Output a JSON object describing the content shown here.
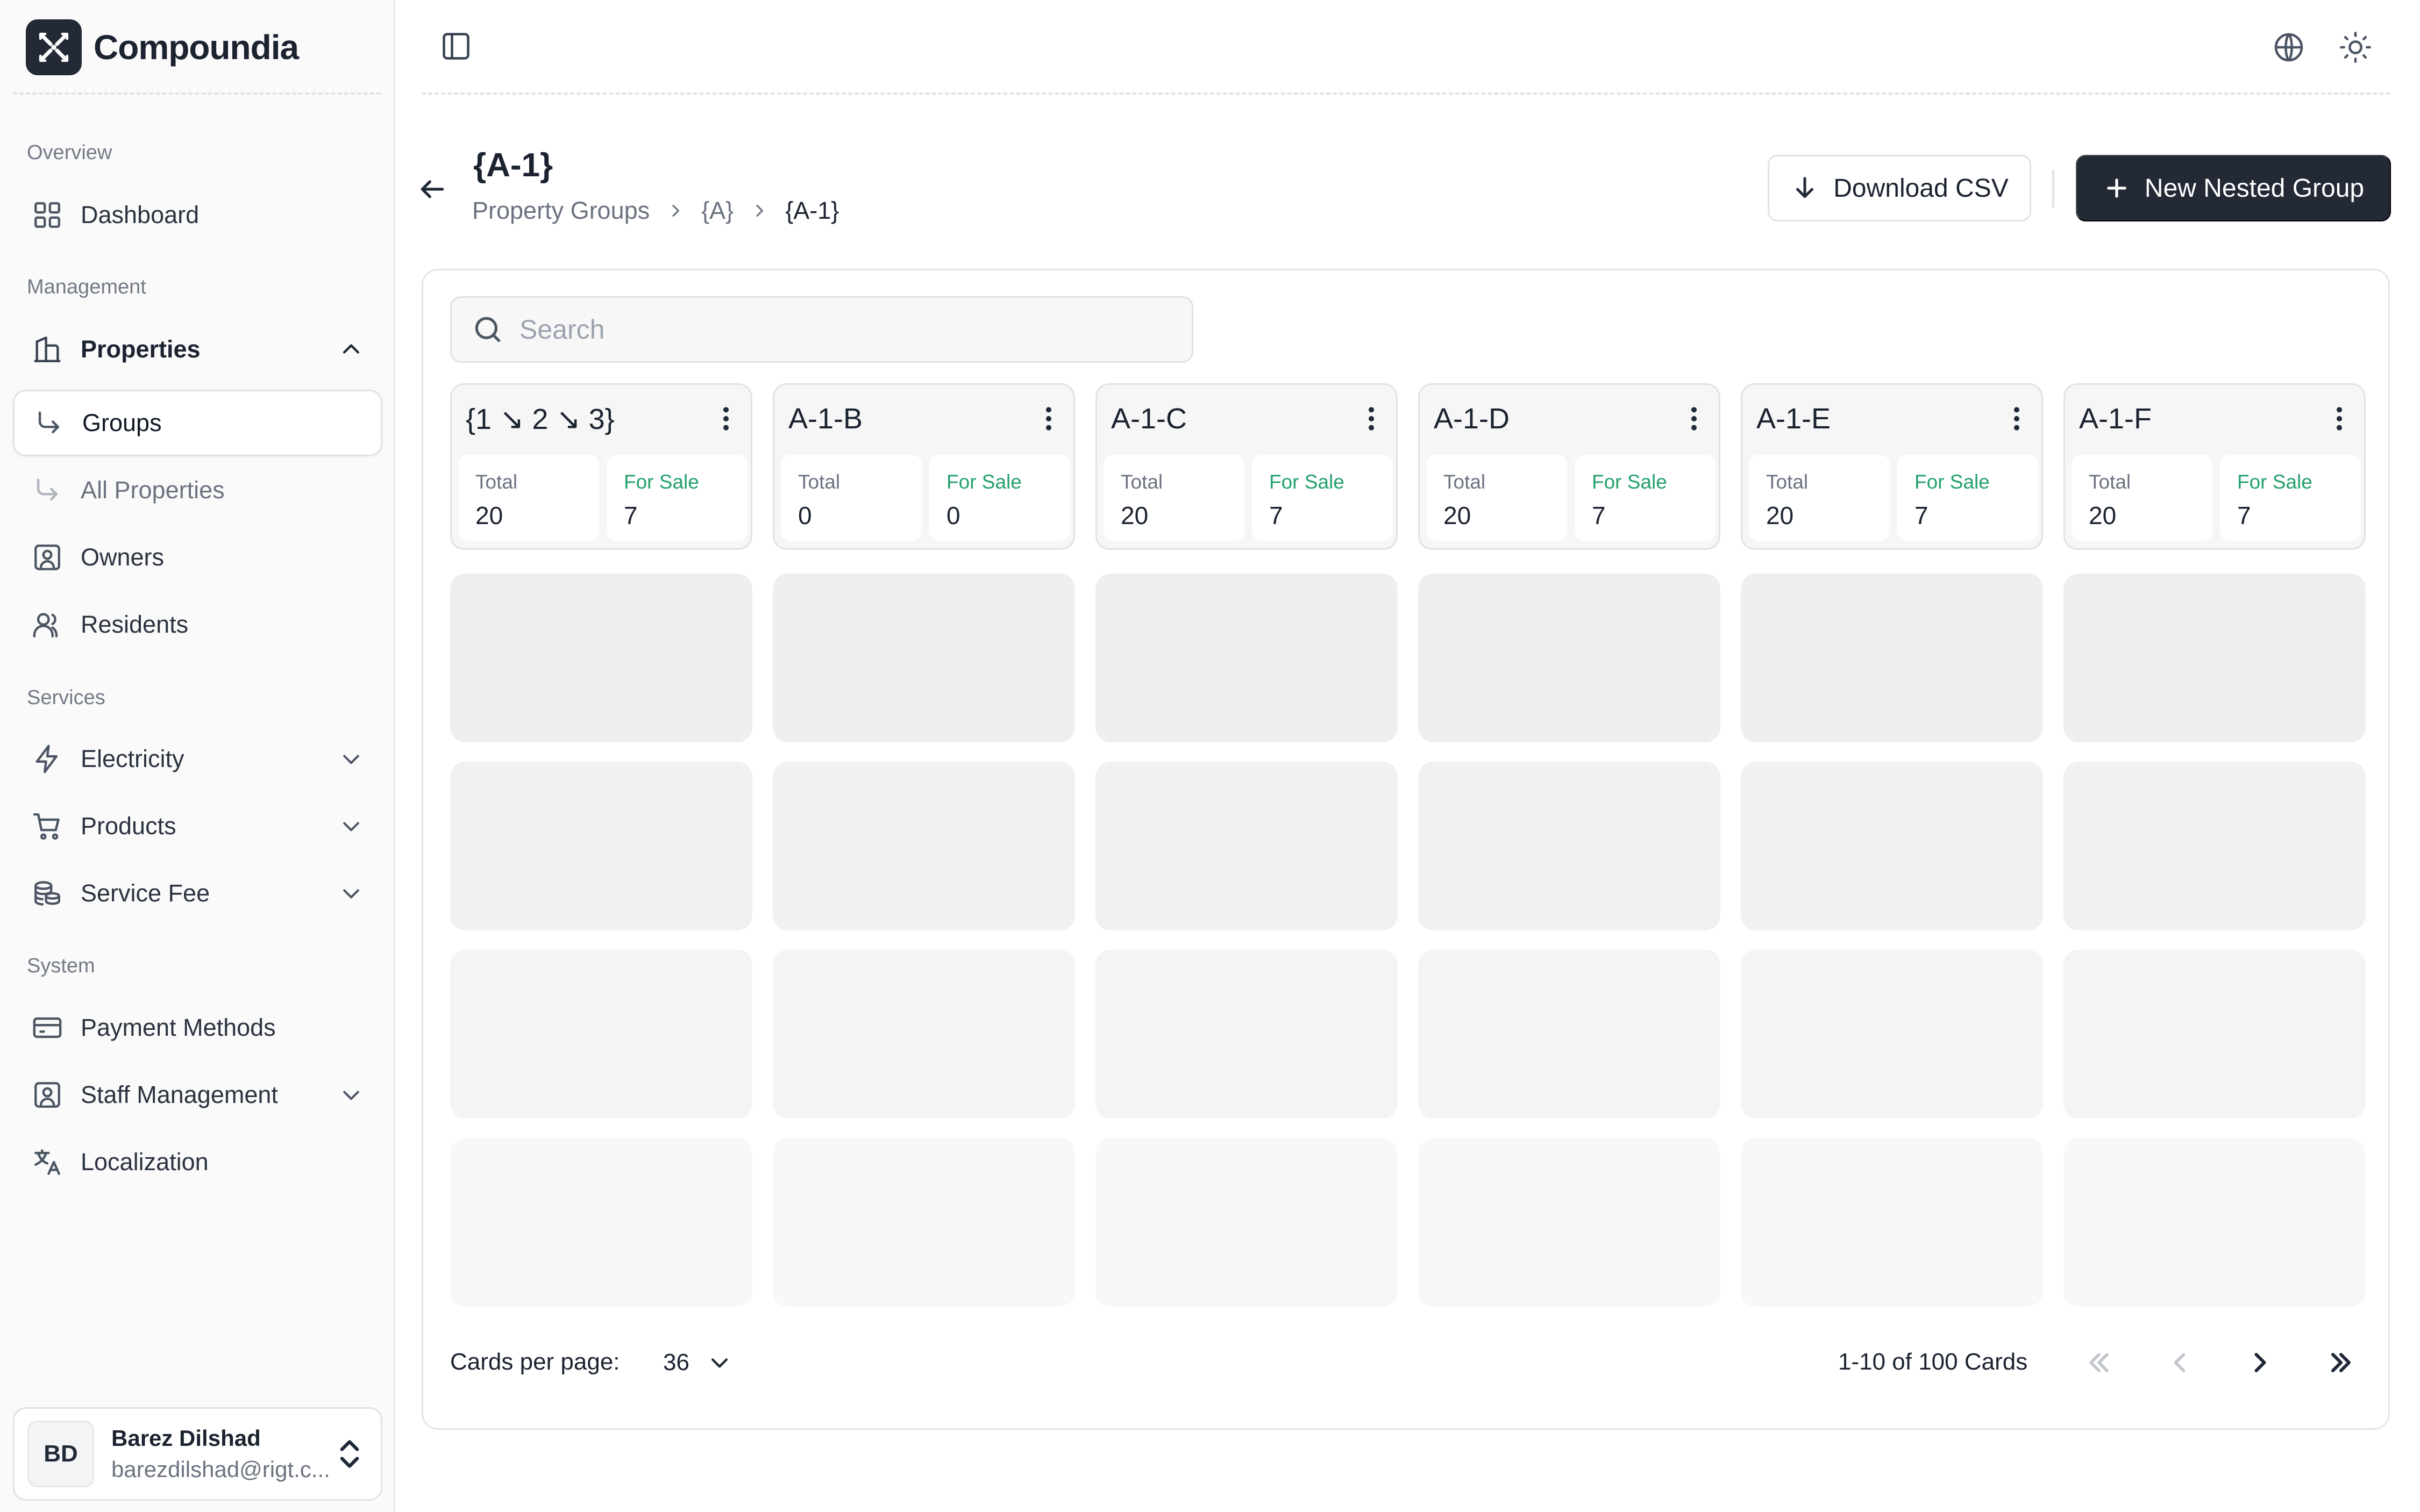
{
  "app": {
    "brand_name": "Compoundia"
  },
  "sidebar": {
    "sections": [
      {
        "label": "Overview"
      },
      {
        "label": "Management"
      },
      {
        "label": "Services"
      },
      {
        "label": "System"
      }
    ],
    "items": [
      {
        "label": "Dashboard",
        "icon": "dashboard-grid-icon"
      },
      {
        "label": "Properties",
        "icon": "building-icon",
        "expanded": true
      },
      {
        "label": "Groups",
        "icon": "sub-arrow-icon",
        "active": true
      },
      {
        "label": "All Properties",
        "icon": "sub-arrow-icon"
      },
      {
        "label": "Owners",
        "icon": "owner-id-icon"
      },
      {
        "label": "Residents",
        "icon": "users-icon"
      },
      {
        "label": "Electricity",
        "icon": "lightning-icon"
      },
      {
        "label": "Products",
        "icon": "shopping-cart-icon"
      },
      {
        "label": "Service Fee",
        "icon": "coins-icon"
      },
      {
        "label": "Payment Methods",
        "icon": "credit-card-icon"
      },
      {
        "label": "Staff Management",
        "icon": "staff-id-icon"
      },
      {
        "label": "Localization",
        "icon": "translate-icon"
      }
    ],
    "user": {
      "initials": "BD",
      "name": "Barez Dilshad",
      "email": "barezdilshad@rigt.c..."
    }
  },
  "header": {
    "title": "{A-1}",
    "breadcrumb": [
      "Property Groups",
      "{A}",
      "{A-1}"
    ],
    "download_label": "Download CSV",
    "new_group_label": "New Nested Group"
  },
  "search": {
    "placeholder": "Search",
    "value": ""
  },
  "cards": [
    {
      "title": "{1 ↘ 2 ↘ 3}",
      "total_label": "Total",
      "total": "20",
      "for_sale_label": "For Sale",
      "for_sale": "7"
    },
    {
      "title": "A-1-B",
      "total_label": "Total",
      "total": "0",
      "for_sale_label": "For Sale",
      "for_sale": "0"
    },
    {
      "title": "A-1-C",
      "total_label": "Total",
      "total": "20",
      "for_sale_label": "For Sale",
      "for_sale": "7"
    },
    {
      "title": "A-1-D",
      "total_label": "Total",
      "total": "20",
      "for_sale_label": "For Sale",
      "for_sale": "7"
    },
    {
      "title": "A-1-E",
      "total_label": "Total",
      "total": "20",
      "for_sale_label": "For Sale",
      "for_sale": "7"
    },
    {
      "title": "A-1-F",
      "total_label": "Total",
      "total": "20",
      "for_sale_label": "For Sale",
      "for_sale": "7"
    }
  ],
  "pagination": {
    "per_page_label": "Cards per page:",
    "per_page_value": "36",
    "range_text": "1-10 of 100 Cards"
  },
  "colors": {
    "primary": "#232a36",
    "accent_green": "#22a06b",
    "skeleton_row_1": "#efefef",
    "skeleton_row_2": "#f1f1f1",
    "skeleton_row_3": "#f4f4f4",
    "skeleton_row_4": "#f8f8f8"
  }
}
